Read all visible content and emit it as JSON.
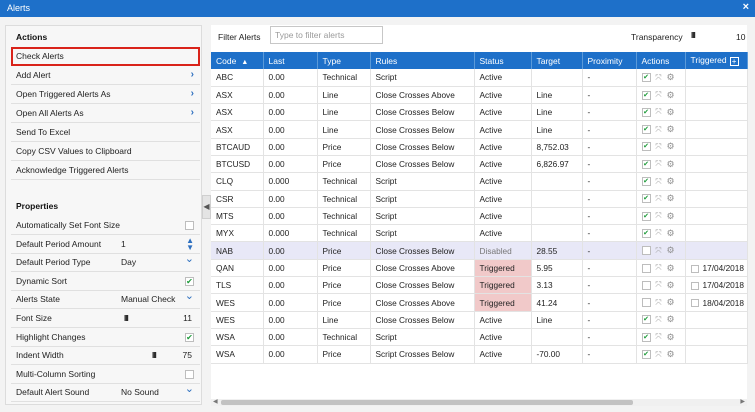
{
  "window": {
    "title": "Alerts",
    "close_label": "×"
  },
  "actions": {
    "title": "Actions",
    "items": [
      {
        "label": "Check Alerts",
        "chevron": false
      },
      {
        "label": "Add Alert",
        "chevron": true
      },
      {
        "label": "Open Triggered Alerts As",
        "chevron": true
      },
      {
        "label": "Open All Alerts As",
        "chevron": true
      },
      {
        "label": "Send To Excel",
        "chevron": false
      },
      {
        "label": "Copy CSV Values to Clipboard",
        "chevron": false
      },
      {
        "label": "Acknowledge Triggered Alerts",
        "chevron": false
      }
    ]
  },
  "properties": {
    "title": "Properties",
    "rows": [
      {
        "label": "Automatically Set Font Size",
        "checked": false
      },
      {
        "label": "Default Period Amount",
        "value": "1"
      },
      {
        "label": "Default Period Type",
        "value": "Day"
      },
      {
        "label": "Dynamic Sort",
        "checked": true
      },
      {
        "label": "Alerts State",
        "value": "Manual Check"
      },
      {
        "label": "Font Size",
        "value": "11"
      },
      {
        "label": "Highlight Changes",
        "checked": true
      },
      {
        "label": "Indent Width",
        "value": "75"
      },
      {
        "label": "Multi-Column Sorting",
        "checked": false
      },
      {
        "label": "Default Alert Sound",
        "value": "No Sound"
      }
    ]
  },
  "toolbar": {
    "filter_label": "Filter Alerts",
    "filter_placeholder": "Type to filter alerts",
    "transparency_label": "Transparency",
    "transparency_value": "10"
  },
  "grid": {
    "columns": [
      "Code",
      "Last",
      "Type",
      "Rules",
      "Status",
      "Target",
      "Proximity",
      "Actions",
      "Triggered"
    ],
    "rows": [
      {
        "code": "ABC",
        "last": "0.00",
        "type": "Technical",
        "rules": "Script",
        "status": "Active",
        "target": "",
        "proximity": "-",
        "enabled": true,
        "triggered": ""
      },
      {
        "code": "ASX",
        "last": "0.00",
        "type": "Line",
        "rules": "Close Crosses Above",
        "status": "Active",
        "target": "Line",
        "proximity": "-",
        "enabled": true,
        "triggered": ""
      },
      {
        "code": "ASX",
        "last": "0.00",
        "type": "Line",
        "rules": "Close Crosses Below",
        "status": "Active",
        "target": "Line",
        "proximity": "-",
        "enabled": true,
        "triggered": ""
      },
      {
        "code": "ASX",
        "last": "0.00",
        "type": "Line",
        "rules": "Close Crosses Below",
        "status": "Active",
        "target": "Line",
        "proximity": "-",
        "enabled": true,
        "triggered": ""
      },
      {
        "code": "BTCAUD",
        "last": "0.00",
        "type": "Price",
        "rules": "Close Crosses Below",
        "status": "Active",
        "target": "8,752.03",
        "proximity": "-",
        "enabled": true,
        "triggered": ""
      },
      {
        "code": "BTCUSD",
        "last": "0.00",
        "type": "Price",
        "rules": "Close Crosses Below",
        "status": "Active",
        "target": "6,826.97",
        "proximity": "-",
        "enabled": true,
        "triggered": ""
      },
      {
        "code": "CLQ",
        "last": "0.000",
        "type": "Technical",
        "rules": "Script",
        "status": "Active",
        "target": "",
        "proximity": "-",
        "enabled": true,
        "triggered": ""
      },
      {
        "code": "CSR",
        "last": "0.00",
        "type": "Technical",
        "rules": "Script",
        "status": "Active",
        "target": "",
        "proximity": "-",
        "enabled": true,
        "triggered": ""
      },
      {
        "code": "MTS",
        "last": "0.00",
        "type": "Technical",
        "rules": "Script",
        "status": "Active",
        "target": "",
        "proximity": "-",
        "enabled": true,
        "triggered": ""
      },
      {
        "code": "MYX",
        "last": "0.000",
        "type": "Technical",
        "rules": "Script",
        "status": "Active",
        "target": "",
        "proximity": "-",
        "enabled": true,
        "triggered": ""
      },
      {
        "code": "NAB",
        "last": "0.00",
        "type": "Price",
        "rules": "Close Crosses Below",
        "status": "Disabled",
        "target": "28.55",
        "proximity": "-",
        "enabled": false,
        "triggered": ""
      },
      {
        "code": "QAN",
        "last": "0.00",
        "type": "Price",
        "rules": "Close Crosses Above",
        "status": "Triggered",
        "target": "5.95",
        "proximity": "-",
        "enabled": false,
        "triggered": "17/04/2018"
      },
      {
        "code": "TLS",
        "last": "0.00",
        "type": "Price",
        "rules": "Close Crosses Below",
        "status": "Triggered",
        "target": "3.13",
        "proximity": "-",
        "enabled": false,
        "triggered": "17/04/2018"
      },
      {
        "code": "WES",
        "last": "0.00",
        "type": "Price",
        "rules": "Close Crosses Above",
        "status": "Triggered",
        "target": "41.24",
        "proximity": "-",
        "enabled": false,
        "triggered": "18/04/2018"
      },
      {
        "code": "WES",
        "last": "0.00",
        "type": "Line",
        "rules": "Close Crosses Below",
        "status": "Active",
        "target": "Line",
        "proximity": "-",
        "enabled": true,
        "triggered": ""
      },
      {
        "code": "WSA",
        "last": "0.00",
        "type": "Technical",
        "rules": "Script",
        "status": "Active",
        "target": "",
        "proximity": "-",
        "enabled": true,
        "triggered": ""
      },
      {
        "code": "WSA",
        "last": "0.00",
        "type": "Price",
        "rules": "Script Crosses Below",
        "status": "Active",
        "target": "-70.00",
        "proximity": "-",
        "enabled": true,
        "triggered": ""
      }
    ]
  },
  "colors": {
    "accent": "#1e70c9",
    "highlight_border": "#d9231a",
    "triggered_bg": "#f1c9c9",
    "disabled_bg": "#e8e8f7",
    "check_green": "#1e9b3a"
  },
  "icons": {
    "check": "check-icon",
    "expand": "expand-icon",
    "gear": "gear-icon",
    "chevron": "chevron-right-icon",
    "add_column": "plus-icon"
  }
}
